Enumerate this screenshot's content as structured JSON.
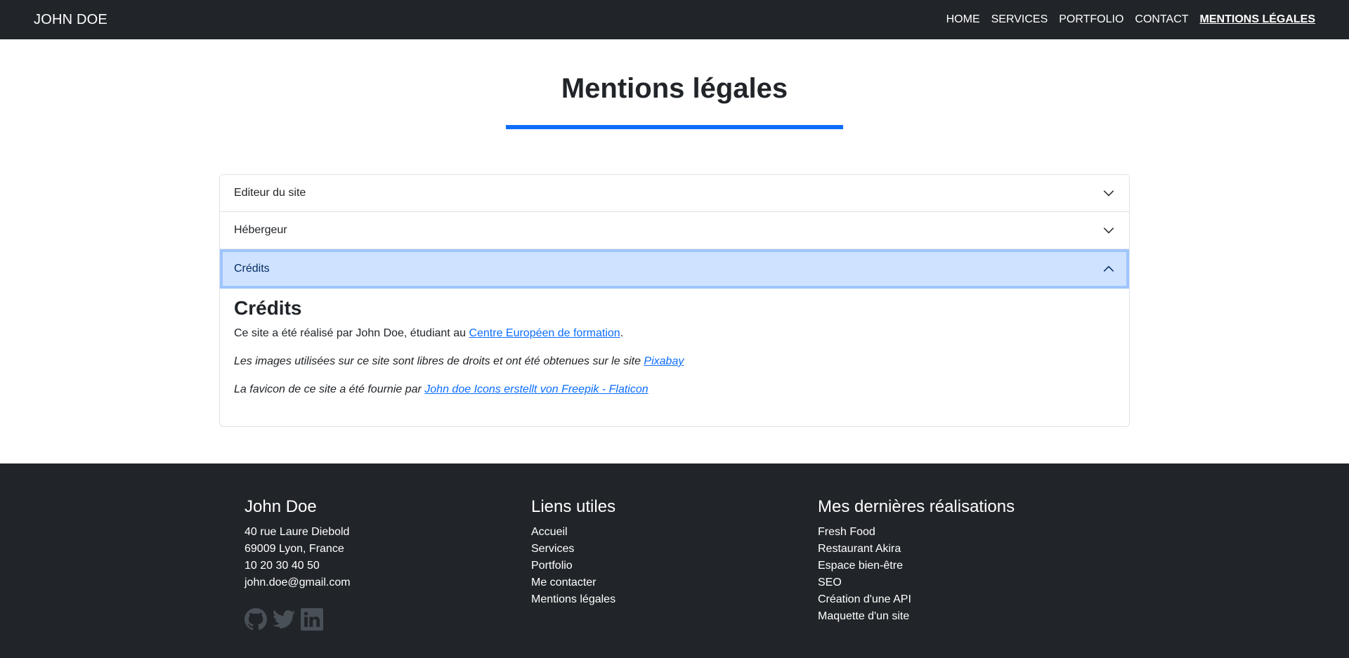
{
  "navbar": {
    "brand": "JOHN DOE",
    "links": [
      "HOME",
      "SERVICES",
      "PORTFOLIO",
      "CONTACT",
      "MENTIONS LÉGALES"
    ]
  },
  "page": {
    "title": "Mentions légales"
  },
  "accordion": {
    "items": [
      {
        "label": "Editeur du site",
        "state": "collapsed"
      },
      {
        "label": "Hébergeur",
        "state": "collapsed"
      },
      {
        "label": "Crédits",
        "state": "expanded"
      }
    ],
    "body": {
      "heading": "Crédits",
      "p1_text": "Ce site a été réalisé par John Doe, étudiant au ",
      "p1_link": "Centre Européen de formation",
      "p1_end": ".",
      "p2_text": "Les images utilisées sur ce site sont libres de droits et ont été obtenues sur le site ",
      "p2_link": "Pixabay",
      "p3_text": "La favicon de ce site a été fournie par ",
      "p3_link": "John doe Icons erstellt von Freepik - Flaticon"
    }
  },
  "footer": {
    "col1": {
      "title": "John Doe",
      "lines": [
        "40 rue Laure Diebold",
        "69009 Lyon, France",
        "10 20 30 40 50",
        "john.doe@gmail.com"
      ]
    },
    "col2": {
      "title": "Liens utiles",
      "links": [
        "Accueil",
        "Services",
        "Portfolio",
        "Me contacter",
        "Mentions légales"
      ]
    },
    "col3": {
      "title": "Mes dernières réalisations",
      "links": [
        "Fresh Food",
        "Restaurant Akira",
        "Espace bien-être",
        "SEO",
        "Création d'une API",
        "Maquette d'un site"
      ]
    },
    "social_icons": [
      "github-icon",
      "twitter-icon",
      "linkedin-icon"
    ]
  },
  "colors": {
    "navbar_bg": "#212529",
    "accent": "#0d6efd",
    "accordion_open_bg": "#cfe2ff"
  }
}
